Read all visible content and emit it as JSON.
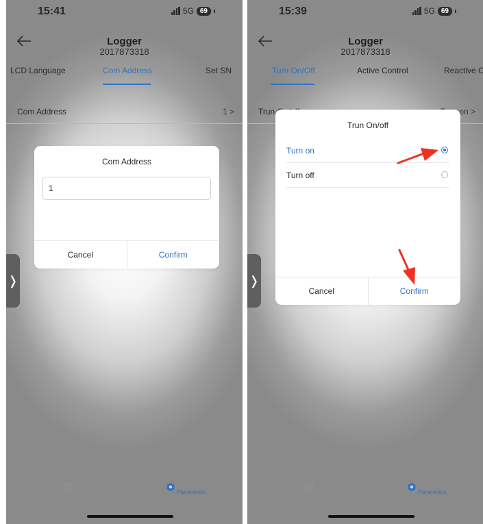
{
  "colors": {
    "accent": "#2f73c6",
    "annotation_red": "#ef3124"
  },
  "left_screen": {
    "status": {
      "time": "15:41",
      "network": "5G",
      "battery": "69"
    },
    "header": {
      "title": "Logger",
      "subtitle": "2017873318"
    },
    "tabs": [
      {
        "label": "LCD Language",
        "active": false
      },
      {
        "label": "Com Address",
        "active": true
      },
      {
        "label": "Set SN",
        "active": false
      }
    ],
    "setting_row": {
      "label": "Com Address",
      "value": "1 >"
    },
    "dialog": {
      "title": "Com Address",
      "input_value": "1",
      "cancel_label": "Cancel",
      "confirm_label": "Confirm"
    },
    "bottom_nav": [
      {
        "label": "Real-time",
        "icon": "gauge-icon",
        "active": false
      },
      {
        "label": "Parameters",
        "icon": "gear-icon",
        "active": true
      }
    ]
  },
  "right_screen": {
    "status": {
      "time": "15:39",
      "network": "5G",
      "battery": "69"
    },
    "header": {
      "title": "Logger",
      "subtitle": "2017873318"
    },
    "tabs": [
      {
        "label": "Turn On/Off",
        "active": true
      },
      {
        "label": "Active Control",
        "active": false
      },
      {
        "label": "Reactive C",
        "active": false
      }
    ],
    "setting_row": {
      "label": "Trun On/off",
      "value": "Turn on >"
    },
    "dialog": {
      "title": "Trun On/off",
      "options": [
        {
          "label": "Turn on",
          "selected": true
        },
        {
          "label": "Turn off",
          "selected": false
        }
      ],
      "cancel_label": "Cancel",
      "confirm_label": "Confirm"
    },
    "bottom_nav": [
      {
        "label": "Real-time",
        "icon": "gauge-icon",
        "active": false
      },
      {
        "label": "Parameters",
        "icon": "gear-icon",
        "active": true
      }
    ]
  }
}
